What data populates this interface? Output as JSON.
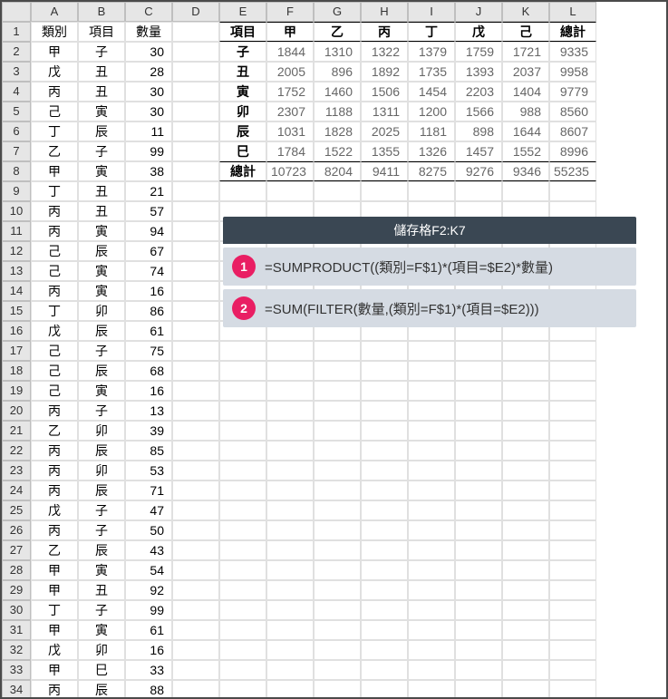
{
  "col_headers": [
    "A",
    "B",
    "C",
    "D",
    "E",
    "F",
    "G",
    "H",
    "I",
    "J",
    "K",
    "L"
  ],
  "row_headers": [
    1,
    2,
    3,
    4,
    5,
    6,
    7,
    8,
    9,
    10,
    11,
    12,
    13,
    14,
    15,
    16,
    17,
    18,
    19,
    20,
    21,
    22,
    23,
    24,
    25,
    26,
    27,
    28,
    29,
    30,
    31,
    32,
    33,
    34
  ],
  "main_headers": [
    "類別",
    "項目",
    "數量"
  ],
  "main_rows": [
    [
      "甲",
      "子",
      30
    ],
    [
      "戊",
      "丑",
      28
    ],
    [
      "丙",
      "丑",
      30
    ],
    [
      "己",
      "寅",
      30
    ],
    [
      "丁",
      "辰",
      11
    ],
    [
      "乙",
      "子",
      99
    ],
    [
      "甲",
      "寅",
      38
    ],
    [
      "丁",
      "丑",
      21
    ],
    [
      "丙",
      "丑",
      57
    ],
    [
      "丙",
      "寅",
      94
    ],
    [
      "己",
      "辰",
      67
    ],
    [
      "己",
      "寅",
      74
    ],
    [
      "丙",
      "寅",
      16
    ],
    [
      "丁",
      "卯",
      86
    ],
    [
      "戊",
      "辰",
      61
    ],
    [
      "己",
      "子",
      75
    ],
    [
      "己",
      "辰",
      68
    ],
    [
      "己",
      "寅",
      16
    ],
    [
      "丙",
      "子",
      13
    ],
    [
      "乙",
      "卯",
      39
    ],
    [
      "丙",
      "辰",
      85
    ],
    [
      "丙",
      "卯",
      53
    ],
    [
      "丙",
      "辰",
      71
    ],
    [
      "戊",
      "子",
      47
    ],
    [
      "丙",
      "子",
      50
    ],
    [
      "乙",
      "辰",
      43
    ],
    [
      "甲",
      "寅",
      54
    ],
    [
      "甲",
      "丑",
      92
    ],
    [
      "丁",
      "子",
      99
    ],
    [
      "甲",
      "寅",
      61
    ],
    [
      "戊",
      "卯",
      16
    ],
    [
      "甲",
      "巳",
      33
    ],
    [
      "丙",
      "辰",
      88
    ]
  ],
  "summary": {
    "row_header": "項目",
    "col_headers": [
      "甲",
      "乙",
      "丙",
      "丁",
      "戊",
      "己",
      "總計"
    ],
    "rows": [
      {
        "label": "子",
        "values": [
          1844,
          1310,
          1322,
          1379,
          1759,
          1721,
          9335
        ]
      },
      {
        "label": "丑",
        "values": [
          2005,
          896,
          1892,
          1735,
          1393,
          2037,
          9958
        ]
      },
      {
        "label": "寅",
        "values": [
          1752,
          1460,
          1506,
          1454,
          2203,
          1404,
          9779
        ]
      },
      {
        "label": "卯",
        "values": [
          2307,
          1188,
          1311,
          1200,
          1566,
          988,
          8560
        ]
      },
      {
        "label": "辰",
        "values": [
          1031,
          1828,
          2025,
          1181,
          898,
          1644,
          8607
        ]
      },
      {
        "label": "巳",
        "values": [
          1784,
          1522,
          1355,
          1326,
          1457,
          1552,
          8996
        ]
      }
    ],
    "total_label": "總計",
    "totals": [
      10723,
      8204,
      9411,
      8275,
      9276,
      9346,
      55235
    ]
  },
  "formula_box": {
    "title": "儲存格F2:K7",
    "formulas": [
      {
        "badge": "1",
        "text": "=SUMPRODUCT((類別=F$1)*(項目=$E2)*數量)"
      },
      {
        "badge": "2",
        "text": "=SUM(FILTER(數量,(類別=F$1)*(項目=$E2)))"
      }
    ]
  },
  "chart_data": {
    "type": "table",
    "title": "",
    "row_labels": [
      "子",
      "丑",
      "寅",
      "卯",
      "辰",
      "巳",
      "總計"
    ],
    "col_labels": [
      "甲",
      "乙",
      "丙",
      "丁",
      "戊",
      "己",
      "總計"
    ],
    "values": [
      [
        1844,
        1310,
        1322,
        1379,
        1759,
        1721,
        9335
      ],
      [
        2005,
        896,
        1892,
        1735,
        1393,
        2037,
        9958
      ],
      [
        1752,
        1460,
        1506,
        1454,
        2203,
        1404,
        9779
      ],
      [
        2307,
        1188,
        1311,
        1200,
        1566,
        988,
        8560
      ],
      [
        1031,
        1828,
        2025,
        1181,
        898,
        1644,
        8607
      ],
      [
        1784,
        1522,
        1355,
        1326,
        1457,
        1552,
        8996
      ],
      [
        10723,
        8204,
        9411,
        8275,
        9276,
        9346,
        55235
      ]
    ]
  }
}
